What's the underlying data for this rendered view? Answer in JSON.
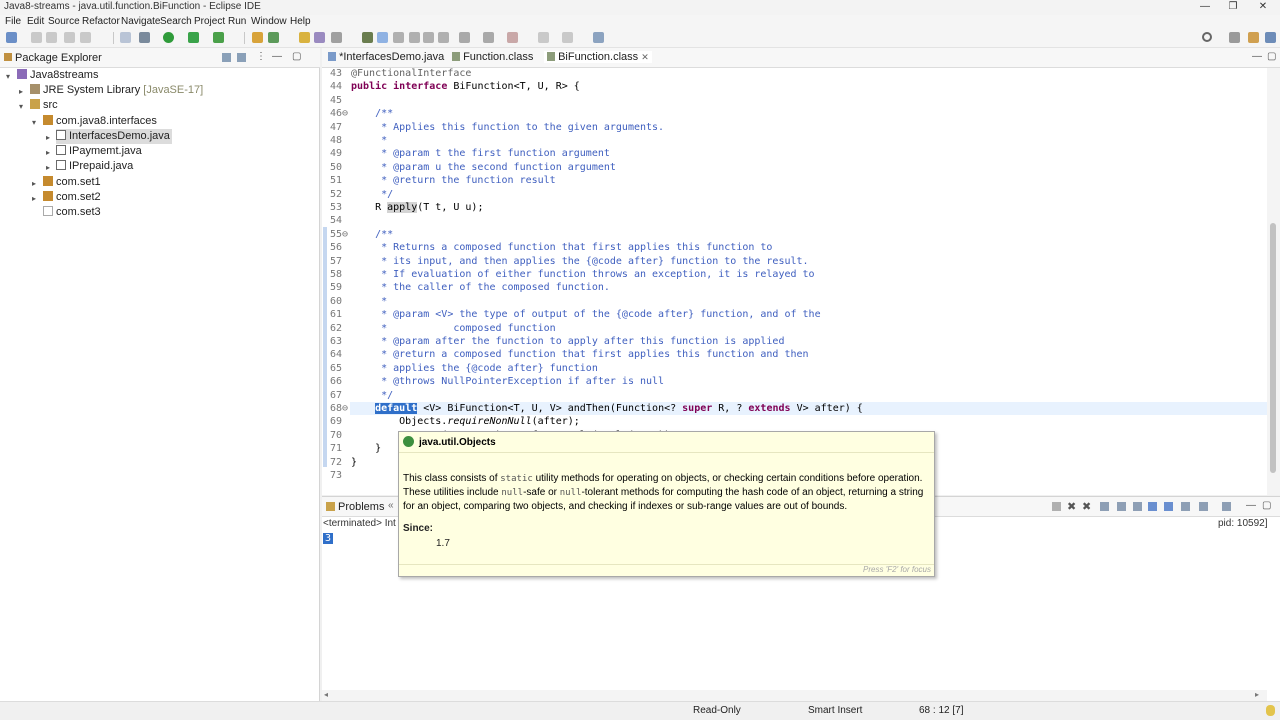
{
  "window": {
    "title": "Java8-streams - java.util.function.BiFunction - Eclipse IDE"
  },
  "menu": [
    "File",
    "Edit",
    "Source",
    "Refactor",
    "Navigate",
    "Search",
    "Project",
    "Run",
    "Window",
    "Help"
  ],
  "package_explorer": {
    "title": "Package Explorer",
    "tree": [
      {
        "label": "Java8streams",
        "icon": "project-icon"
      },
      {
        "label": "JRE System Library",
        "suffix": "[JavaSE-17]",
        "icon": "library-icon"
      },
      {
        "label": "src",
        "icon": "source-folder-icon"
      },
      {
        "label": "com.java8.interfaces",
        "icon": "package-icon"
      },
      {
        "label": "InterfacesDemo.java",
        "icon": "java-interface-file-icon"
      },
      {
        "label": "IPaymemt.java",
        "icon": "java-interface-file-icon"
      },
      {
        "label": "IPrepaid.java",
        "icon": "java-interface-file-icon"
      },
      {
        "label": "com.set1",
        "icon": "package-icon"
      },
      {
        "label": "com.set2",
        "icon": "package-icon"
      },
      {
        "label": "com.set3",
        "icon": "empty-package-icon"
      }
    ]
  },
  "editor": {
    "tabs": [
      {
        "label": "*InterfacesDemo.java",
        "icon": "java-file-icon"
      },
      {
        "label": "Function.class",
        "icon": "class-file-icon"
      },
      {
        "label": "BiFunction.class",
        "icon": "class-file-icon",
        "active": true,
        "close": "✕"
      }
    ],
    "lines": [
      {
        "n": "43",
        "text": "@FunctionalInterface",
        "kind": "ann"
      },
      {
        "n": "44",
        "text": "public interface BiFunction<T, U, R> {",
        "kind": "decl"
      },
      {
        "n": "45",
        "text": ""
      },
      {
        "n": "46⊖",
        "text": "    /**",
        "kind": "cm"
      },
      {
        "n": "47",
        "text": "     * Applies this function to the given arguments.",
        "kind": "cm"
      },
      {
        "n": "48",
        "text": "     *",
        "kind": "cm"
      },
      {
        "n": "49",
        "text": "     * @param t the first function argument",
        "kind": "cm"
      },
      {
        "n": "50",
        "text": "     * @param u the second function argument",
        "kind": "cm"
      },
      {
        "n": "51",
        "text": "     * @return the function result",
        "kind": "cm"
      },
      {
        "n": "52",
        "text": "     */",
        "kind": "cm"
      },
      {
        "n": "53",
        "text": "    R apply(T t, U u);",
        "kind": "plain"
      },
      {
        "n": "54",
        "text": ""
      },
      {
        "n": "55⊖",
        "text": "    /**",
        "kind": "cm"
      },
      {
        "n": "56",
        "text": "     * Returns a composed function that first applies this function to",
        "kind": "cm"
      },
      {
        "n": "57",
        "text": "     * its input, and then applies the {@code after} function to the result.",
        "kind": "cm"
      },
      {
        "n": "58",
        "text": "     * If evaluation of either function throws an exception, it is relayed to",
        "kind": "cm"
      },
      {
        "n": "59",
        "text": "     * the caller of the composed function.",
        "kind": "cm"
      },
      {
        "n": "60",
        "text": "     *",
        "kind": "cm"
      },
      {
        "n": "61",
        "text": "     * @param <V> the type of output of the {@code after} function, and of the",
        "kind": "cm"
      },
      {
        "n": "62",
        "text": "     *           composed function",
        "kind": "cm"
      },
      {
        "n": "63",
        "text": "     * @param after the function to apply after this function is applied",
        "kind": "cm"
      },
      {
        "n": "64",
        "text": "     * @return a composed function that first applies this function and then",
        "kind": "cm"
      },
      {
        "n": "65",
        "text": "     * applies the {@code after} function",
        "kind": "cm"
      },
      {
        "n": "66",
        "text": "     * @throws NullPointerException if after is null",
        "kind": "cm"
      },
      {
        "n": "67",
        "text": "     */",
        "kind": "cm"
      },
      {
        "n": "68⊖",
        "text": "    default <V> BiFunction<T, U, V> andThen(Function<? super R, ? extends V> after) {",
        "kind": "default"
      },
      {
        "n": "69",
        "text": "        Objects.requireNonNull(after);",
        "kind": "call"
      },
      {
        "n": "70",
        "text": "        return (T t, U u) -> after.apply(apply(t, u));",
        "kind": "hidden"
      },
      {
        "n": "71",
        "text": "    }",
        "kind": "plain"
      },
      {
        "n": "72",
        "text": "}",
        "kind": "plain"
      },
      {
        "n": "73",
        "text": ""
      }
    ]
  },
  "bottom_panel": {
    "tab": "Problems",
    "terminated": "<terminated> Int",
    "pid": "pid: 10592]",
    "console_value": "3"
  },
  "hover": {
    "title": "java.util.Objects",
    "p1": "This class consists of",
    "p1_code": "static",
    "p1_rest": "utility methods for operating on objects, or checking certain conditions before operation.",
    "p2a": "These utilities include",
    "p2_code1": "null",
    "p2b": "-safe or",
    "p2_code2": "null",
    "p2c": "-tolerant methods for computing the hash code of an object, returning a string",
    "p3": "for an object, comparing two objects, and checking if indexes or sub-range values are out of bounds.",
    "since_label": "Since:",
    "since_value": "1.7",
    "footer": "Press 'F2' for focus"
  },
  "status": {
    "read_only": "Read-Only",
    "insert_mode": "Smart Insert",
    "position": "68 : 12 [7]"
  }
}
